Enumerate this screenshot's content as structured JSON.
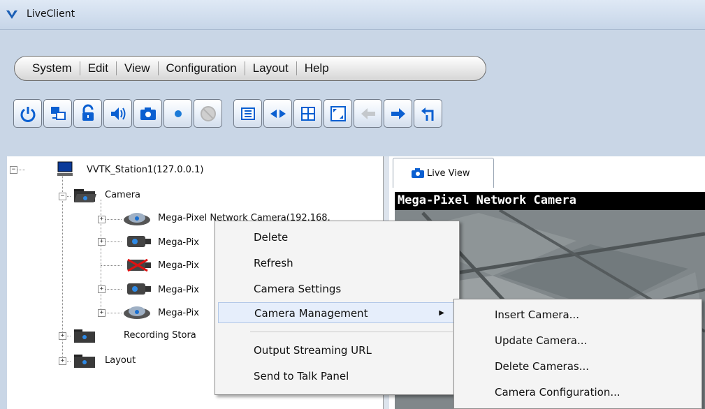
{
  "window": {
    "title": "LiveClient"
  },
  "menu": [
    "System",
    "Edit",
    "View",
    "Configuration",
    "Layout",
    "Help"
  ],
  "toolbar": {
    "icons": [
      "power-icon",
      "network-icon",
      "lock-icon",
      "speaker-icon",
      "camera-icon",
      "record-icon",
      "disabled-icon",
      "settings-icon",
      "swap-icon",
      "grid-icon",
      "fullscreen-icon",
      "back-arrow-icon",
      "forward-arrow-icon",
      "return-icon"
    ],
    "accent": "#0a5fd1"
  },
  "tree": {
    "station": "VVTK_Station1(127.0.0.1)",
    "camera_folder": "Camera",
    "cameras": [
      "Mega-Pixel Network Camera(192.168.",
      "Mega-Pix",
      "Mega-Pix",
      "Mega-Pix",
      "Mega-Pix"
    ],
    "recording": "Recording Stora",
    "layout": "Layout"
  },
  "tab": {
    "label": "Live View"
  },
  "video": {
    "title": "Mega-Pixel Network Camera"
  },
  "context_menu": {
    "items": [
      "Delete",
      "Refresh",
      "Camera Settings",
      "Camera Management",
      "Output Streaming URL",
      "Send to Talk Panel"
    ]
  },
  "submenu": {
    "items": [
      "Insert Camera...",
      "Update Camera...",
      "Delete Cameras...",
      "Camera Configuration..."
    ]
  }
}
